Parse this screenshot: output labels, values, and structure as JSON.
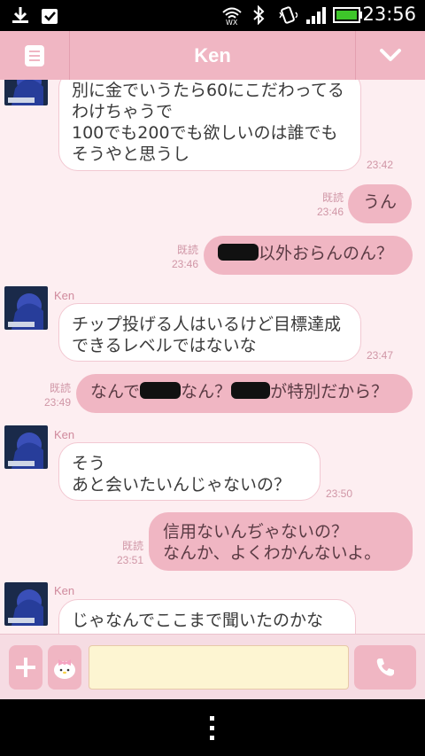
{
  "status_bar": {
    "time": "23:56",
    "icons": [
      "download-icon",
      "task-done-icon",
      "wifi-icon",
      "bluetooth-icon",
      "vibrate-icon",
      "signal-icon",
      "battery-icon"
    ]
  },
  "header": {
    "title": "Ken",
    "left_icon": "menu-icon",
    "right_icon": "chevron-down-icon"
  },
  "chat": {
    "sender_name": "Ken",
    "read_label": "既読",
    "messages": [
      {
        "dir": "in",
        "text": "別に金でいうたら60にこだわってるわけちゃうで\n100でも200でも欲しいのは誰でもそうやと思うし",
        "time": "23:42"
      },
      {
        "dir": "out",
        "text": "うん",
        "time": "23:46",
        "read": "既読"
      },
      {
        "dir": "out",
        "text": "以外おらんのん？",
        "time": "23:46",
        "read": "既読"
      },
      {
        "dir": "in",
        "sender": "Ken",
        "text": "チップ投げる人はいるけど目標達成できるレベルではないな",
        "time": "23:47"
      },
      {
        "dir": "out",
        "text_parts": [
          "なんで",
          "なん？",
          "が特別だから？"
        ],
        "time": "23:49",
        "read": "既読"
      },
      {
        "dir": "in",
        "sender": "Ken",
        "text": "そう\nあと会いたいんじゃないの？",
        "time": "23:50"
      },
      {
        "dir": "out",
        "text": "信用ないんぢゃないの？\nなんか、よくわかんないよ。",
        "time": "23:51",
        "read": "既読"
      },
      {
        "dir": "in",
        "sender": "Ken",
        "text": "じゃなんでここまで聞いたのかな",
        "time": ""
      }
    ]
  },
  "input_bar": {
    "add_icon": "plus-icon",
    "sticker_icon": "sticker-icon",
    "input_value": "",
    "call_icon": "phone-icon"
  },
  "nav_bar": {
    "menu_icon": "overflow-menu-icon"
  },
  "colors": {
    "header": "#f0b6c3",
    "chat_bg": "#fdeef1",
    "outgoing_bubble": "#f0b6c3",
    "incoming_bubble": "#ffffff",
    "input_bg": "#fdf5d2"
  }
}
